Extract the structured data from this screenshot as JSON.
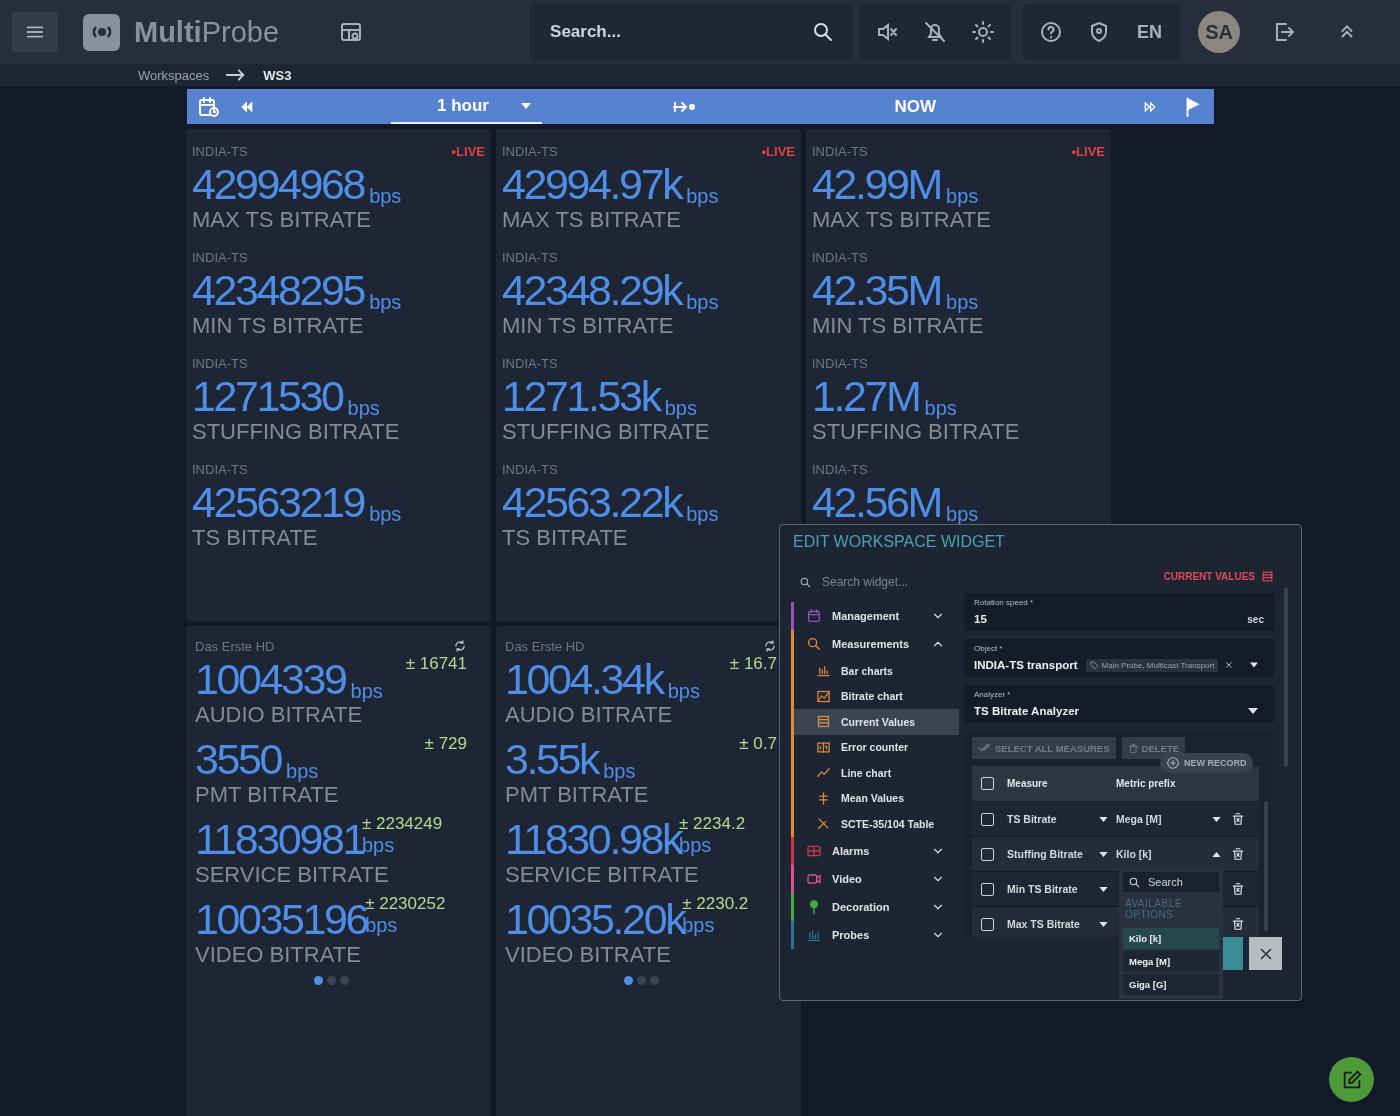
{
  "header": {
    "brand_bold": "Multi",
    "brand_light": "Probe",
    "search": {
      "placeholder": "Search..."
    },
    "language": "EN",
    "avatar": "SA"
  },
  "breadcrumb": [
    "Workspaces",
    "WS3"
  ],
  "time_bar": {
    "range": "1 hour",
    "now": "NOW"
  },
  "cards": [
    {
      "live_label": "•LIVE",
      "metrics": [
        {
          "source": "INDIA-TS",
          "value": "42994968",
          "unit": "bps",
          "label": "MAX TS BITRATE"
        },
        {
          "source": "INDIA-TS",
          "value": "42348295",
          "unit": "bps",
          "label": "MIN TS BITRATE"
        },
        {
          "source": "INDIA-TS",
          "value": "1271530",
          "unit": "bps",
          "label": "STUFFING BITRATE"
        },
        {
          "source": "INDIA-TS",
          "value": "42563219",
          "unit": "bps",
          "label": "TS BITRATE"
        }
      ]
    },
    {
      "live_label": "•LIVE",
      "metrics": [
        {
          "source": "INDIA-TS",
          "value": "42994.97k",
          "unit": "bps",
          "label": "MAX TS BITRATE"
        },
        {
          "source": "INDIA-TS",
          "value": "42348.29k",
          "unit": "bps",
          "label": "MIN TS BITRATE"
        },
        {
          "source": "INDIA-TS",
          "value": "1271.53k",
          "unit": "bps",
          "label": "STUFFING BITRATE"
        },
        {
          "source": "INDIA-TS",
          "value": "42563.22k",
          "unit": "bps",
          "label": "TS BITRATE"
        }
      ]
    },
    {
      "live_label": "•LIVE",
      "metrics": [
        {
          "source": "INDIA-TS",
          "value": "42.99M",
          "unit": "bps",
          "label": "MAX TS BITRATE"
        },
        {
          "source": "INDIA-TS",
          "value": "42.35M",
          "unit": "bps",
          "label": "MIN TS BITRATE"
        },
        {
          "source": "INDIA-TS",
          "value": "1.27M",
          "unit": "bps",
          "label": "STUFFING BITRATE"
        },
        {
          "source": "INDIA-TS",
          "value": "42.56M",
          "unit": "bps"
        }
      ]
    },
    {
      "source": "Das Erste HD",
      "metrics": [
        {
          "kind": "inline",
          "value": "1004339",
          "unit": "bps",
          "deviation": "± 16741",
          "label": "AUDIO BITRATE"
        },
        {
          "kind": "inline",
          "value": "3550",
          "unit": "bps",
          "deviation": "± 729",
          "label": "PMT BITRATE"
        },
        {
          "kind": "stacked",
          "value": "11830981",
          "unit": "bps",
          "deviation": "± 2234249",
          "label": "SERVICE BITRATE"
        },
        {
          "kind": "stacked",
          "value": "10035196",
          "unit": "bps",
          "deviation": "± 2230252",
          "label": "VIDEO BITRATE"
        }
      ],
      "pages": [
        {
          "selected": true
        },
        {
          "selected": false
        },
        {
          "selected": false
        }
      ]
    },
    {
      "source": "Das Erste HD",
      "metrics": [
        {
          "kind": "inline",
          "value": "1004.34k",
          "unit": "bps",
          "deviation": "± 16.7",
          "label": "AUDIO BITRATE"
        },
        {
          "kind": "inline",
          "value": "3.55k",
          "unit": "bps",
          "deviation": "± 0.7",
          "label": "PMT BITRATE"
        },
        {
          "kind": "stacked",
          "value": "11830.98k",
          "unit": "bps",
          "deviation": "± 2234.2",
          "label": "SERVICE BITRATE"
        },
        {
          "kind": "stacked",
          "value": "10035.20k",
          "unit": "bps",
          "deviation": "± 2230.2",
          "label": "VIDEO BITRATE"
        }
      ],
      "pages": [
        {
          "selected": true
        },
        {
          "selected": false
        },
        {
          "selected": false
        }
      ]
    }
  ],
  "dialog": {
    "title": "EDIT WORKSPACE WIDGET",
    "search": {
      "placeholder": "Search widget..."
    },
    "categories": [
      {
        "label": "Management",
        "color": "#9b4fc4",
        "expanded": false
      },
      {
        "label": "Measurements",
        "color": "#e58a35",
        "expanded": true,
        "children": [
          {
            "label": "Bar charts",
            "selected": false
          },
          {
            "label": "Bitrate chart",
            "selected": false
          },
          {
            "label": "Current Values",
            "selected": true
          },
          {
            "label": "Error counter",
            "selected": false
          },
          {
            "label": "Line chart",
            "selected": false
          },
          {
            "label": "Mean Values",
            "selected": false
          },
          {
            "label": "SCTE-35/104 Table",
            "selected": false
          }
        ]
      },
      {
        "label": "Alarms",
        "color": "#d0344c",
        "expanded": false
      },
      {
        "label": "Video",
        "color": "#e0508e",
        "expanded": false
      },
      {
        "label": "Decoration",
        "color": "#45a843",
        "expanded": false
      },
      {
        "label": "Probes",
        "color": "#2e6f9c",
        "expanded": false
      }
    ],
    "widget_type": "CURRENT VALUES",
    "fields": [
      {
        "label": "Rotation speed *",
        "value": "15",
        "suffix": "sec"
      },
      {
        "label": "Object *",
        "value": "INDIA-TS transport",
        "tag": "Main Probe, Multicast Transport"
      },
      {
        "label": "Analyzer *",
        "value": "TS Bitrate Analyzer"
      }
    ],
    "actions": {
      "select_all": "SELECT ALL MEASURES",
      "delete": "DELETE",
      "new_record": "NEW RECORD"
    },
    "table": {
      "all_checked": false,
      "columns": [
        "Measure",
        "Metric prefix"
      ],
      "rows": [
        {
          "checked": false,
          "measure": "TS Bitrate",
          "prefix": "Mega [M]",
          "expanded": false
        },
        {
          "checked": false,
          "measure": "Stuffing Bitrate",
          "prefix": "Kilo [k]",
          "expanded": true
        },
        {
          "checked": false,
          "measure": "Min TS Bitrate"
        },
        {
          "checked": false,
          "measure": "Max TS Bitrate"
        }
      ]
    },
    "dropdown": {
      "placeholder": "Search",
      "heading": "AVAILABLE OPTIONS",
      "options": [
        {
          "label": "Kilo [k]",
          "selected": true
        },
        {
          "label": "Mega [M]",
          "selected": false
        },
        {
          "label": "Giga [G]",
          "selected": false
        }
      ]
    }
  }
}
